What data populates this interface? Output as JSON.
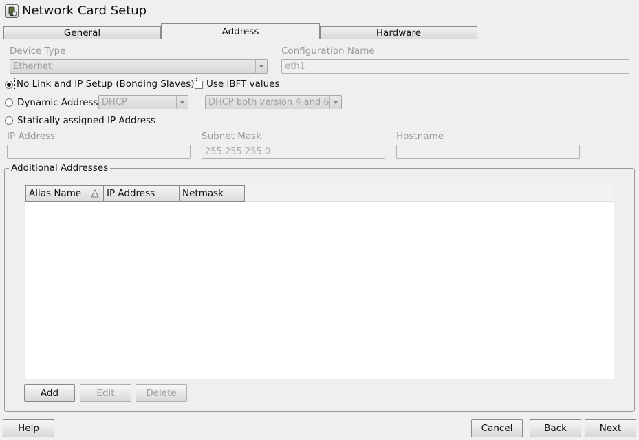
{
  "window": {
    "title": "Network Card Setup",
    "icon": "network-card-icon"
  },
  "tabs": [
    {
      "label": "General",
      "active": false
    },
    {
      "label": "Address",
      "active": true
    },
    {
      "label": "Hardware",
      "active": false
    }
  ],
  "device_type": {
    "label": "Device Type",
    "value": "Ethernet"
  },
  "config_name": {
    "label": "Configuration Name",
    "value": "eth1"
  },
  "radios": {
    "no_link": "No Link and IP Setup (Bonding Slaves)",
    "dynamic": "Dynamic Address",
    "static": "Statically assigned IP Address",
    "selected": "no_link"
  },
  "ibft": {
    "label": "Use iBFT values",
    "checked": false
  },
  "dynamic_method": {
    "value": "DHCP"
  },
  "dhcp_version": {
    "value": "DHCP both version 4 and 6"
  },
  "ip_address": {
    "label": "IP Address",
    "value": ""
  },
  "subnet_mask": {
    "label": "Subnet Mask",
    "value": "255.255.255.0"
  },
  "hostname": {
    "label": "Hostname",
    "value": ""
  },
  "additional": {
    "title": "Additional Addresses",
    "columns": [
      "Alias Name",
      "IP Address",
      "Netmask"
    ],
    "rows": [],
    "add": "Add",
    "edit": "Edit",
    "delete": "Delete"
  },
  "footer": {
    "help": "Help",
    "cancel": "Cancel",
    "back": "Back",
    "next": "Next"
  }
}
